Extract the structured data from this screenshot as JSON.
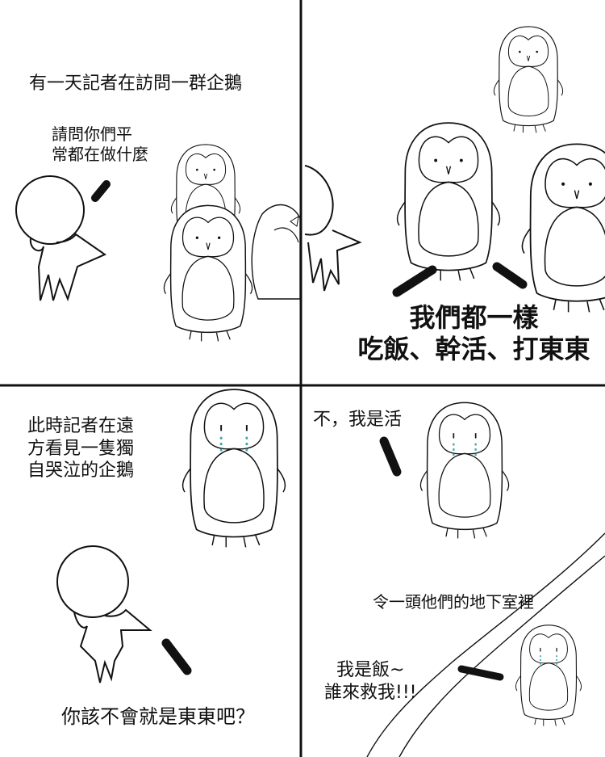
{
  "panels": {
    "p1": {
      "narration": "有一天記者在訪問一群企鵝",
      "reporter_speech": "請問你們平\n常都在做什麼"
    },
    "p2": {
      "penguin_speech": "我們都一樣\n吃飯、幹活、打東東"
    },
    "p3": {
      "narration": "此時記者在遠\n方看見一隻獨\n自哭泣的企鵝"
    },
    "p4": {
      "penguin_speech": "不，我是活",
      "narration": "令一頭他們的地下室裡",
      "trapped_speech": "我是飯~\n誰來救我!!!",
      "reporter_speech": "你該不會就是東東吧？"
    }
  },
  "colors": {
    "ink": "#111111",
    "tears": "#3aa6a6"
  }
}
